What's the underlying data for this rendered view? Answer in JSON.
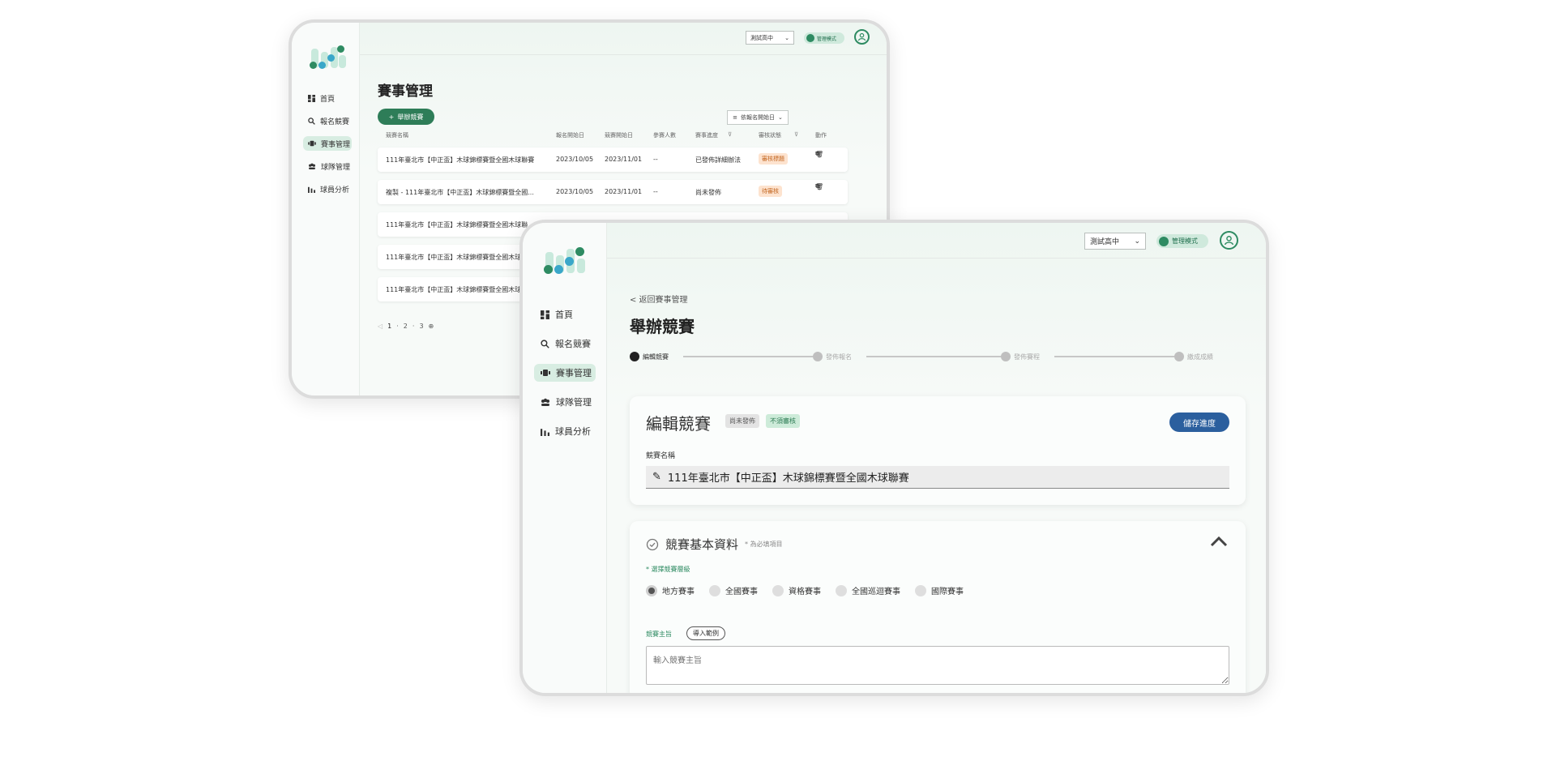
{
  "colors": {
    "brand_green": "#2e7d58",
    "primary_blue": "#2b5f9e",
    "active_nav_bg": "#d8ede2",
    "orange_badge": "#fde3cf"
  },
  "nav_items": [
    {
      "label": "首頁",
      "icon": "dashboard-icon"
    },
    {
      "label": "報名競賽",
      "icon": "search-icon"
    },
    {
      "label": "賽事管理",
      "icon": "trophy-icon",
      "active": true
    },
    {
      "label": "球隊管理",
      "icon": "team-icon"
    },
    {
      "label": "球員分析",
      "icon": "bar-chart-icon"
    }
  ],
  "topbar": {
    "school_select": "測試高中",
    "mode_toggle": "管理模式"
  },
  "win1": {
    "page_title": "賽事管理",
    "add_button": "舉辦競賽",
    "sort_select": "依報名開始日",
    "columns": [
      "競賽名稱",
      "報名開始日",
      "競賽開始日",
      "參賽人數",
      "賽事進度",
      "審核狀態",
      "動作"
    ],
    "rows": [
      {
        "name": "111年臺北市【中正盃】木球錦標賽暨全國木球聯賽",
        "signup": "2023/10/05",
        "start": "2023/11/01",
        "count": "--",
        "progress": "已發佈詳細辦法",
        "status": "審核標題"
      },
      {
        "name": "複製 - 111年臺北市【中正盃】木球錦標賽暨全國...",
        "signup": "2023/10/05",
        "start": "2023/11/01",
        "count": "--",
        "progress": "尚未發佈",
        "status": "待審核"
      },
      {
        "name": "111年臺北市【中正盃】木球錦標賽暨全國木球聯"
      },
      {
        "name": "111年臺北市【中正盃】木球錦標賽暨全國木球聯"
      },
      {
        "name": "111年臺北市【中正盃】木球錦標賽暨全國木球聯"
      }
    ],
    "pagination": {
      "current": "1",
      "p2": "2",
      "p3": "3"
    }
  },
  "win2": {
    "breadcrumb": "< 返回賽事管理",
    "page_title": "舉辦競賽",
    "steps": [
      "編輯競賽",
      "發佈報名",
      "發佈賽程",
      "繳成成績"
    ],
    "edit_card": {
      "title": "編輯競賽",
      "tag_status": "尚未發佈",
      "tag_review": "不須審核",
      "save_button": "儲存進度",
      "name_label": "競賽名稱",
      "name_value": "111年臺北市【中正盃】木球錦標賽暨全國木球聯賽"
    },
    "basic_card": {
      "title": "競賽基本資料",
      "note": "* 為必填項目",
      "level_label": "* 選擇競賽層級",
      "levels": [
        "地方賽事",
        "全國賽事",
        "資格賽事",
        "全國巡迴賽事",
        "國際賽事"
      ],
      "selected_level": "地方賽事",
      "host_label": "競賽主旨",
      "import_button": "導入範例",
      "host_placeholder": "輸入競賽主旨"
    }
  }
}
